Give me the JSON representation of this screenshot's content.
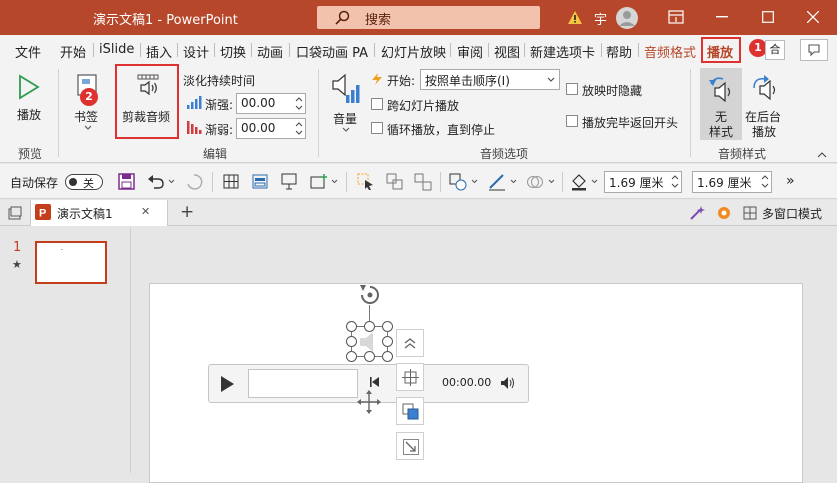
{
  "titlebar": {
    "doc_title": "演示文稿1",
    "separator": "-",
    "app_name": "PowerPoint",
    "search_label": "搜索",
    "user_initial": "宇",
    "colors": {
      "bar": "#b7472a",
      "search": "#f3c2ad"
    }
  },
  "tabs": [
    {
      "label": "文件"
    },
    {
      "label": "开始"
    },
    {
      "label": "iSlide"
    },
    {
      "label": "插入"
    },
    {
      "label": "设计"
    },
    {
      "label": "切换"
    },
    {
      "label": "动画"
    },
    {
      "label": "口袋动画 PA"
    },
    {
      "label": "幻灯片放映"
    },
    {
      "label": "审阅"
    },
    {
      "label": "视图"
    },
    {
      "label": "新建选项卡"
    },
    {
      "label": "帮助"
    },
    {
      "label": "音频格式"
    },
    {
      "label": "播放"
    }
  ],
  "tabs_right": {
    "share_label": "合"
  },
  "ribbon": {
    "preview": {
      "play_label": "播放",
      "group_label": "预览"
    },
    "bookmark": {
      "label": "书签"
    },
    "edit": {
      "trim_label": "剪裁音频",
      "fade_title": "淡化持续时间",
      "fade_in_label": "渐强:",
      "fade_in_value": "00.00",
      "fade_out_label": "渐弱:",
      "fade_out_value": "00.00",
      "group_label": "编辑"
    },
    "audio_options": {
      "volume_label": "音量",
      "start_label": "开始:",
      "start_value": "按照单击顺序(I)",
      "across_slides": "跨幻灯片播放",
      "loop": "循环播放，直到停止",
      "hide_during_show": "放映时隐藏",
      "rewind": "播放完毕返回开头",
      "group_label": "音频选项"
    },
    "audio_styles": {
      "no_style_line1": "无",
      "no_style_line2": "样式",
      "bg_play_line1": "在后台",
      "bg_play_line2": "播放",
      "group_label": "音频样式"
    }
  },
  "annotations": {
    "badge1": "1",
    "badge2": "2",
    "color": "#e03131"
  },
  "qat": {
    "autosave_label": "自动保存",
    "toggle_state": "关",
    "width_value": "1.69 厘米",
    "height_value": "1.69 厘米",
    "overflow": "»"
  },
  "doctabs": {
    "tab_title": "演示文稿1",
    "close": "✕",
    "add": "+",
    "multi_window": "多窗口模式"
  },
  "slides": {
    "number": "1",
    "star": "★"
  },
  "player": {
    "time": "00:00.00"
  }
}
